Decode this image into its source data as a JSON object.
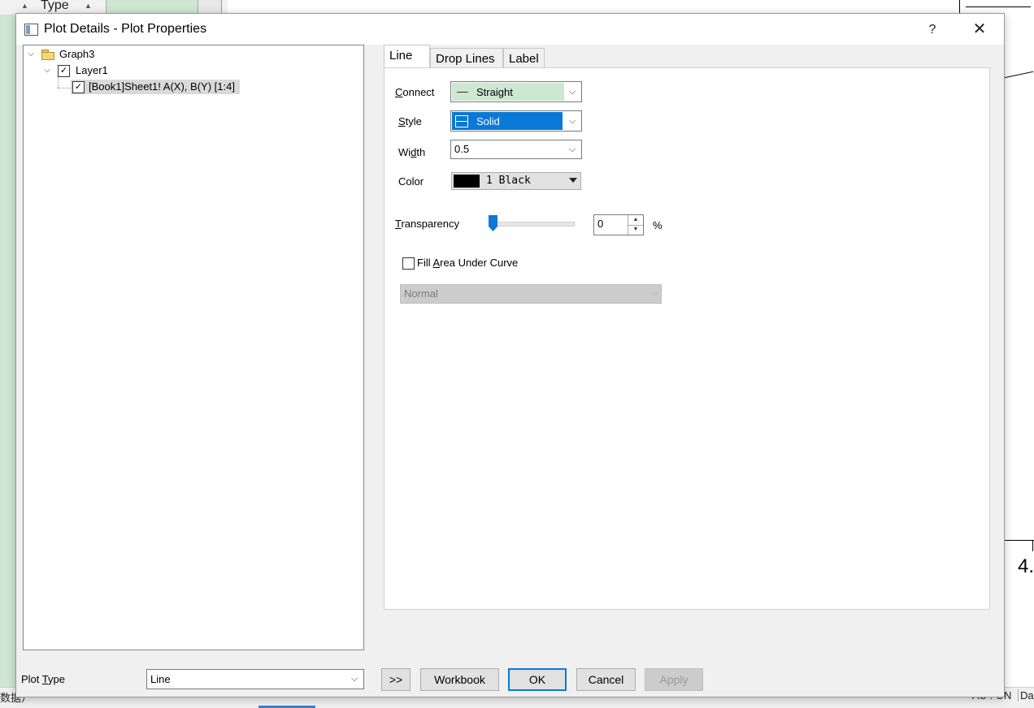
{
  "background": {
    "type_header": "Type",
    "graph_tick_label": "4.",
    "status_left": "数据）",
    "status_right": "AU : ON",
    "status_right2": "Dar"
  },
  "dialog": {
    "title": "Plot Details - Plot Properties",
    "help_label": "?",
    "close_label": "✕"
  },
  "tree": {
    "root": {
      "label": "Graph3",
      "expanded": true
    },
    "layer": {
      "label": "Layer1",
      "checked": true,
      "expanded": true
    },
    "plot": {
      "label": "[Book1]Sheet1! A(X), B(Y) [1:4]",
      "checked": true,
      "selected": true
    }
  },
  "tabs": [
    {
      "label": "Line",
      "active": true
    },
    {
      "label": "Drop Lines",
      "active": false
    },
    {
      "label": "Label",
      "active": false
    }
  ],
  "line_tab": {
    "connect": {
      "label_pre": "",
      "label_u": "C",
      "label_post": "onnect",
      "value": "Straight"
    },
    "style": {
      "label_pre": "",
      "label_u": "S",
      "label_post": "tyle",
      "value": "Solid"
    },
    "width": {
      "label_pre": "Wi",
      "label_u": "d",
      "label_post": "th",
      "value": "0.5"
    },
    "color": {
      "label": "Color",
      "value": "1 Black",
      "swatch": "#000000"
    },
    "transparency": {
      "label_pre": "",
      "label_u": "T",
      "label_post": "ransparency",
      "value": "0",
      "unit": "%",
      "level_percent": 0
    },
    "fill_area": {
      "label_pre": "Fill ",
      "label_u": "A",
      "label_post": "rea Under Curve",
      "checked": false
    },
    "fill_mode": {
      "value": "Normal",
      "disabled": true
    }
  },
  "footer": {
    "plot_type": {
      "label_pre": "Plot ",
      "label_u": "T",
      "label_post": "ype",
      "value": "Line"
    },
    "buttons": {
      "expand": ">>",
      "workbook": "Workbook",
      "ok": "OK",
      "cancel": "Cancel",
      "apply": "Apply"
    }
  },
  "colors": {
    "accent": "#0a78d7",
    "connect_bg": "#cde8d0",
    "dialog_bg": "#f0f0f0"
  }
}
